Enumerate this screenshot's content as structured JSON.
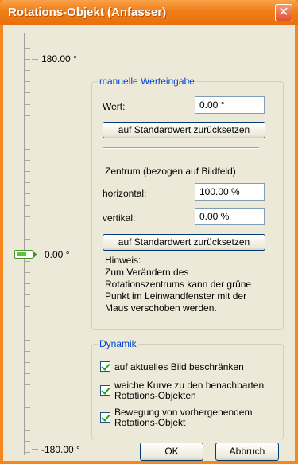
{
  "window": {
    "title": "Rotations-Objekt (Anfasser)",
    "close_glyph": "✕"
  },
  "slider": {
    "max_label": "180.00 °",
    "mid_label": "0.00 °",
    "min_label": "-180.00 °",
    "value": 0.0
  },
  "manual": {
    "title": "manuelle Werteingabe",
    "wert_label": "Wert:",
    "wert_value": "0.00 °",
    "reset_label": "auf Standardwert zurücksetzen",
    "center_heading": "Zentrum (bezogen auf Bildfeld)",
    "horizontal_label": "horizontal:",
    "horizontal_value": "100.00 %",
    "vertical_label": "vertikal:",
    "vertical_value": "0.00 %",
    "reset2_label": "auf Standardwert zurücksetzen",
    "hint_lines": [
      "Hinweis:",
      "Zum Verändern des",
      "Rotationszentrums kann der grüne",
      "Punkt  im Leinwandfenster mit der",
      "Maus verschoben werden."
    ]
  },
  "dynamik": {
    "title": "Dynamik",
    "options": [
      {
        "label_lines": [
          "auf aktuelles Bild beschränken"
        ],
        "checked": true
      },
      {
        "label_lines": [
          "weiche Kurve zu den benachbarten",
          "Rotations-Objekten"
        ],
        "checked": true
      },
      {
        "label_lines": [
          "Bewegung von vorhergehendem",
          "Rotations-Objekt"
        ],
        "checked": true
      }
    ]
  },
  "footer": {
    "ok_label": "OK",
    "cancel_label": "Abbruch"
  },
  "colors": {
    "title_orange": "#f07d17",
    "group_title_blue": "#0046d5",
    "check_green": "#21a121"
  }
}
